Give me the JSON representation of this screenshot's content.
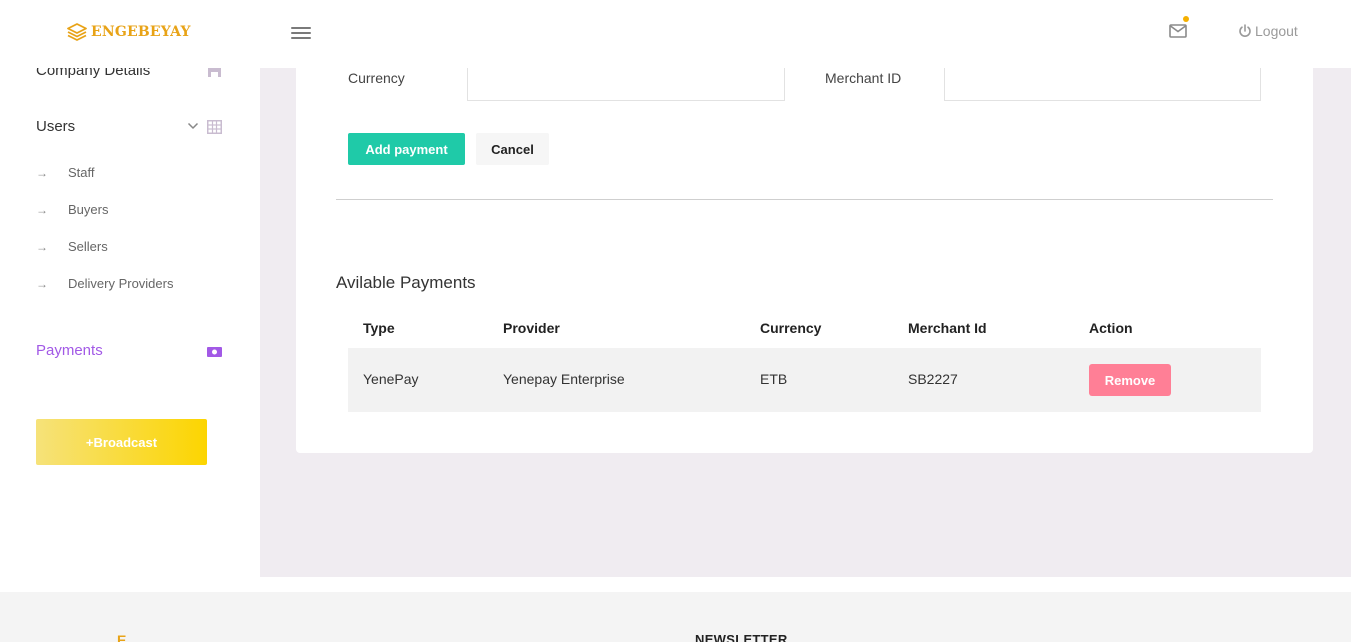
{
  "brand": {
    "name": "ENGEBEYAY",
    "color": "#e8a317"
  },
  "header": {
    "logout_label": "Logout",
    "notification_dot_color": "#f5b000"
  },
  "sidebar": {
    "company_details": "Company Details",
    "users": "Users",
    "sub_items": [
      {
        "label": "Staff"
      },
      {
        "label": "Buyers"
      },
      {
        "label": "Sellers"
      },
      {
        "label": "Delivery Providers"
      }
    ],
    "payments": "Payments",
    "active_color": "#a259e6",
    "broadcast_label": "+Broadcast"
  },
  "form": {
    "currency_label": "Currency",
    "currency_value": "",
    "merchant_label": "Merchant ID",
    "merchant_value": "",
    "add_button": "Add payment",
    "cancel_button": "Cancel"
  },
  "payments_table": {
    "title": "Avilable Payments",
    "headers": [
      "Type",
      "Provider",
      "Currency",
      "Merchant Id",
      "Action"
    ],
    "rows": [
      {
        "type": "YenePay",
        "provider": "Yenepay Enterprise",
        "currency": "ETB",
        "merchant_id": "SB2227",
        "action": "Remove"
      }
    ]
  },
  "footer": {
    "logo_fragment": "E",
    "newsletter": "NEWSLETTER"
  },
  "colors": {
    "accent": "#1fcaa8",
    "danger": "#ff7f96",
    "broadcast_start": "#f6e27a",
    "broadcast_end": "#fcd500"
  }
}
